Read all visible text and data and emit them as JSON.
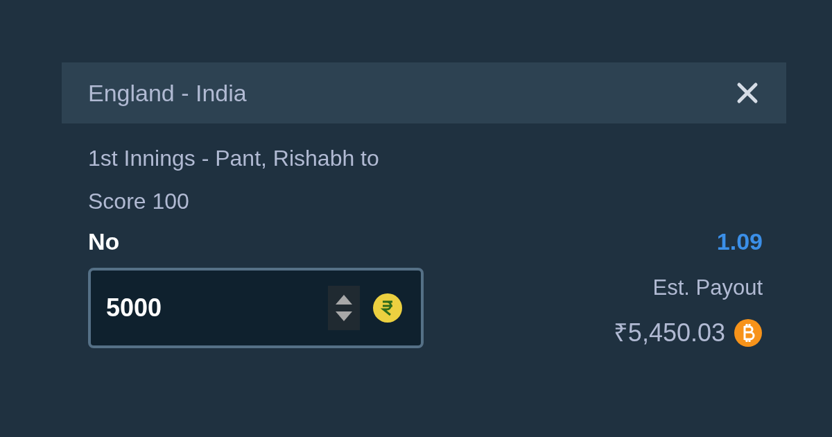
{
  "header": {
    "title": "England - India"
  },
  "market": {
    "line_1": "1st Innings - Pant, Rishabh to",
    "line_2": "Score 100"
  },
  "selection": {
    "label": "No",
    "odds": "1.09"
  },
  "stake": {
    "value": "5000"
  },
  "payout": {
    "label": "Est. Payout",
    "amount": "₹5,450.03"
  }
}
